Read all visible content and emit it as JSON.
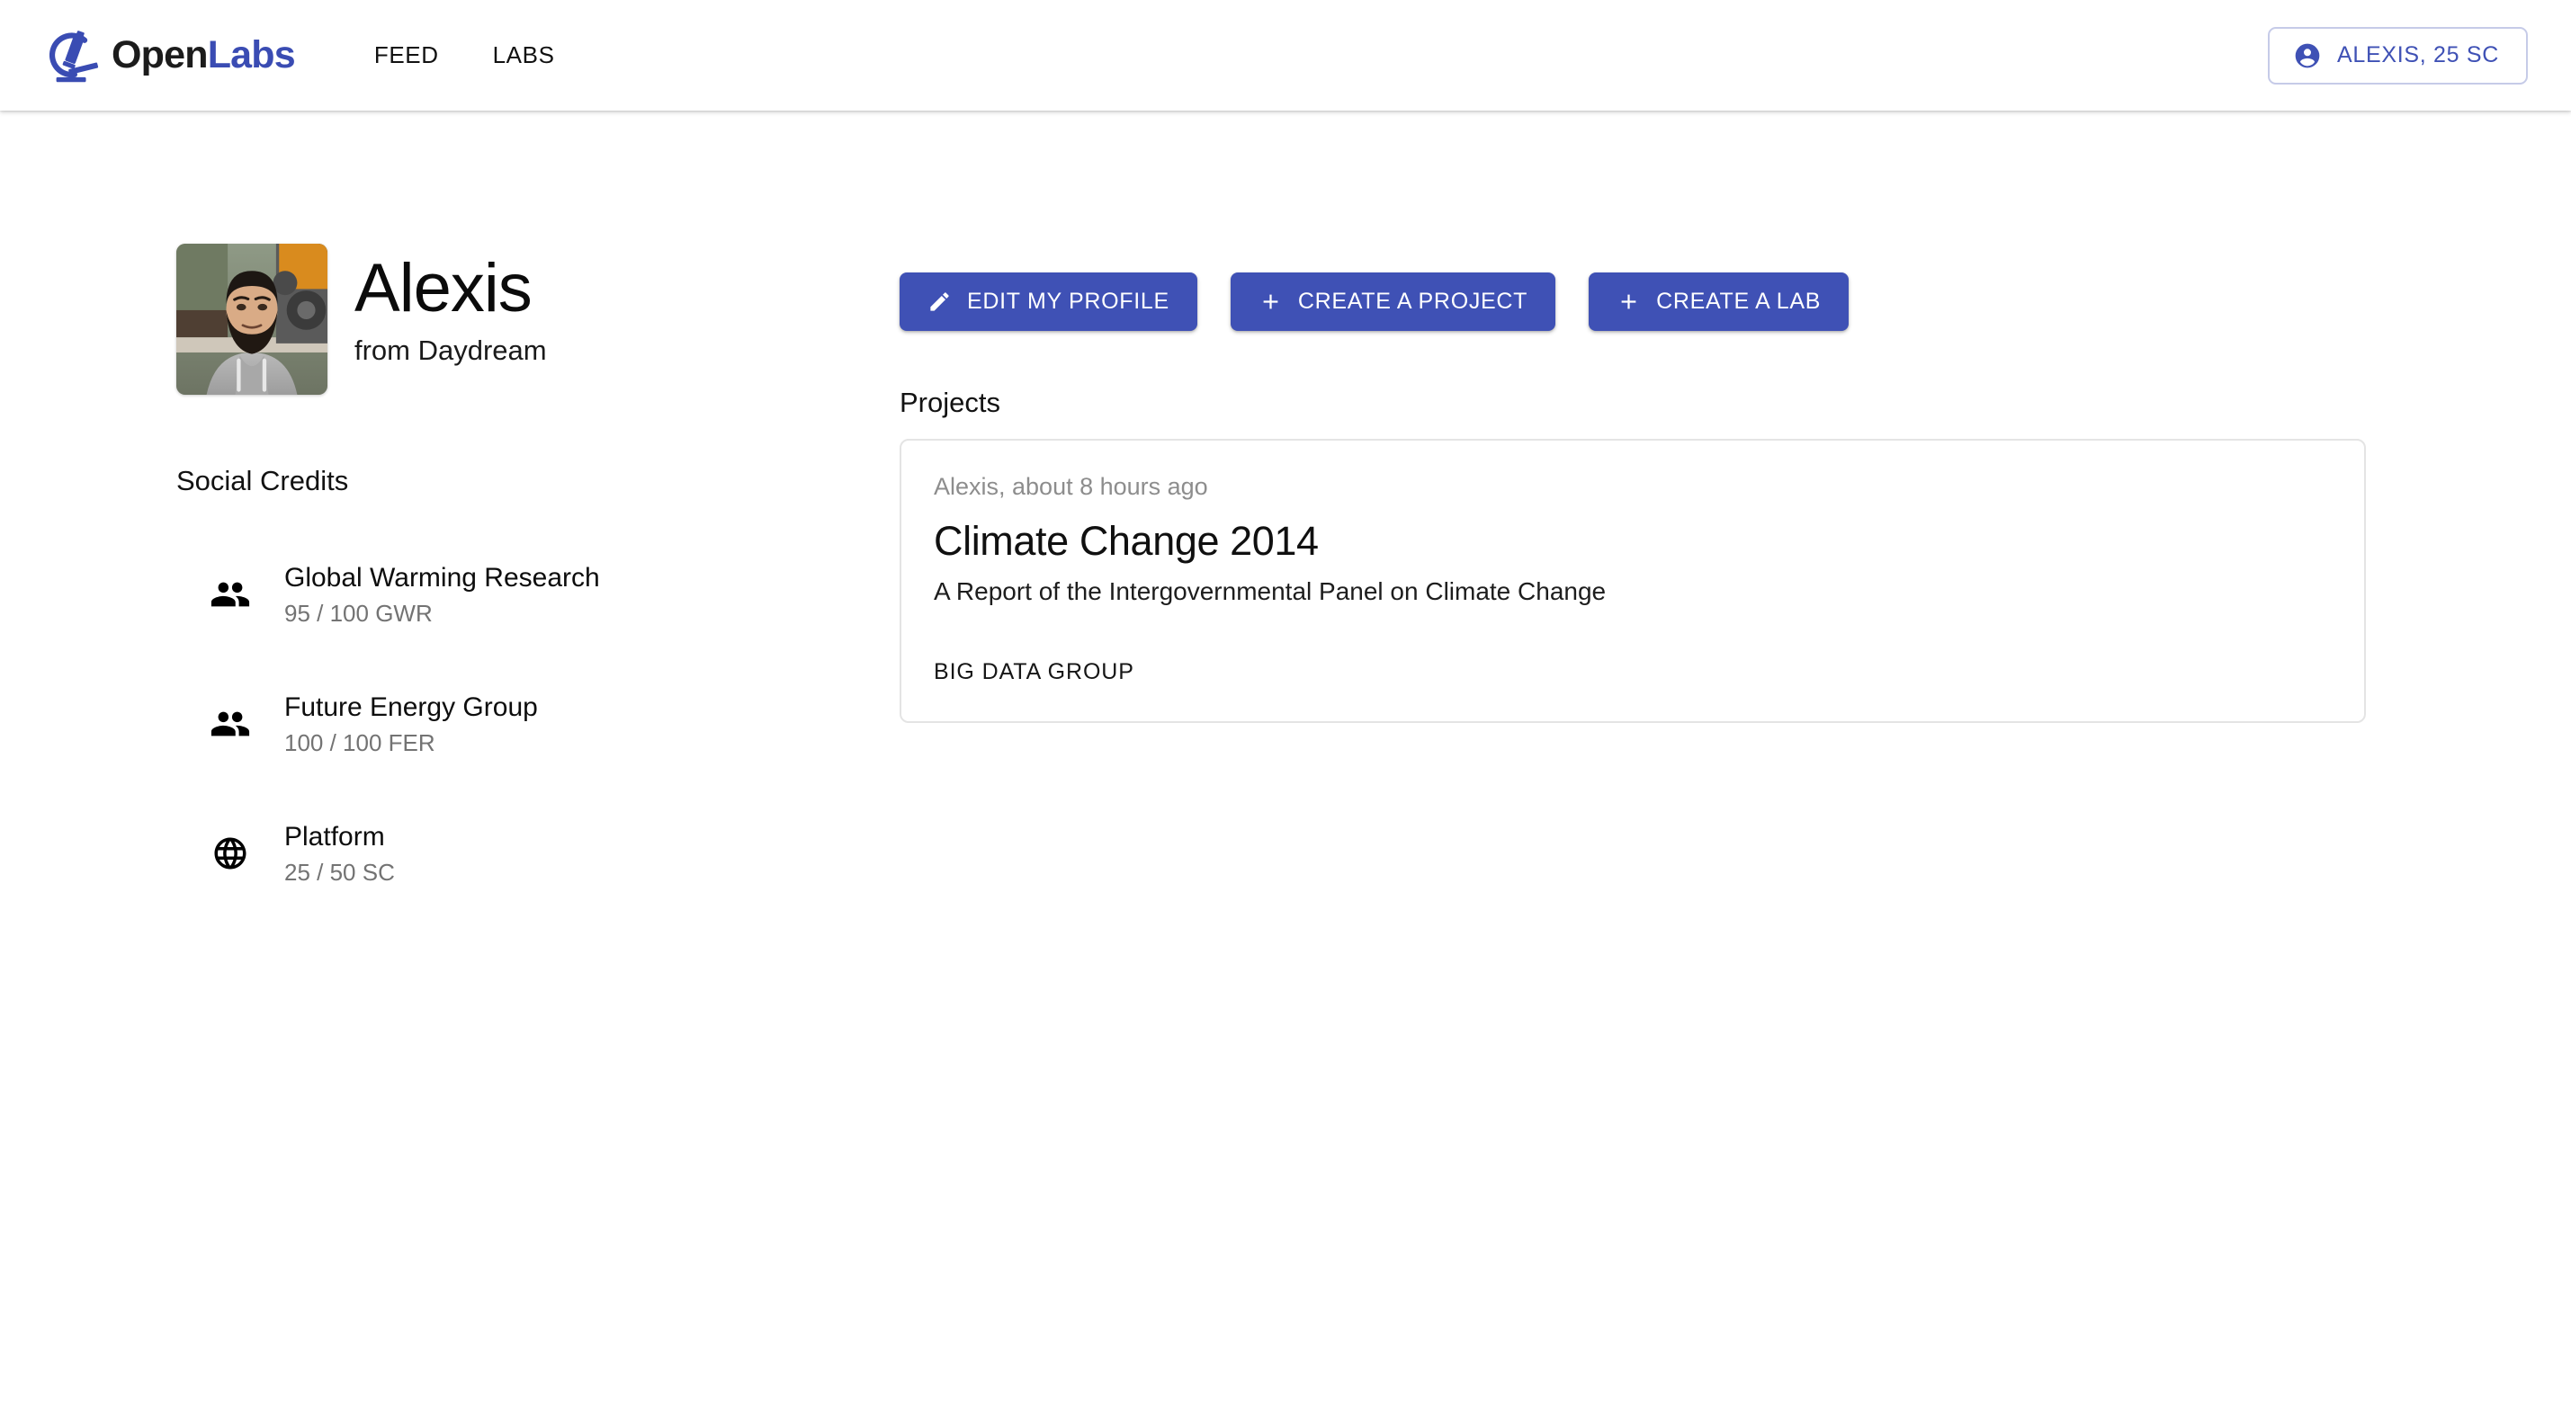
{
  "header": {
    "brand": {
      "logo_icon": "microscope-icon",
      "text_primary": "Open",
      "text_accent": "Labs",
      "accent_color": "#3a4cb3"
    },
    "nav": [
      {
        "label": "FEED",
        "name": "nav-link-feed"
      },
      {
        "label": "LABS",
        "name": "nav-link-labs"
      }
    ],
    "account": {
      "icon": "account-circle-icon",
      "label": "ALEXIS, 25 SC",
      "color": "#3f51b5",
      "border_color": "#c6cbe8"
    }
  },
  "profile": {
    "avatar_icon": "user-photo",
    "name": "Alexis",
    "subtitle": "from Daydream"
  },
  "social_credits": {
    "title": "Social Credits",
    "items": [
      {
        "icon": "people-icon",
        "label": "Global Warming Research",
        "value": "95 / 100 GWR"
      },
      {
        "icon": "people-icon",
        "label": "Future Energy Group",
        "value": "100 / 100 FER"
      },
      {
        "icon": "globe-icon",
        "label": "Platform",
        "value": "25 / 50 SC"
      }
    ]
  },
  "actions": {
    "buttons": [
      {
        "icon": "pencil-icon",
        "label": "EDIT MY PROFILE"
      },
      {
        "icon": "plus-icon",
        "label": "CREATE A PROJECT"
      },
      {
        "icon": "plus-icon",
        "label": "CREATE A LAB"
      }
    ],
    "accent_color": "#3f51b5"
  },
  "projects": {
    "title": "Projects",
    "cards": [
      {
        "meta": "Alexis, about 8 hours ago",
        "title": "Climate Change 2014",
        "description": "A Report of the Intergovernmental Panel on Climate Change",
        "footer": "BIG DATA GROUP"
      }
    ]
  }
}
